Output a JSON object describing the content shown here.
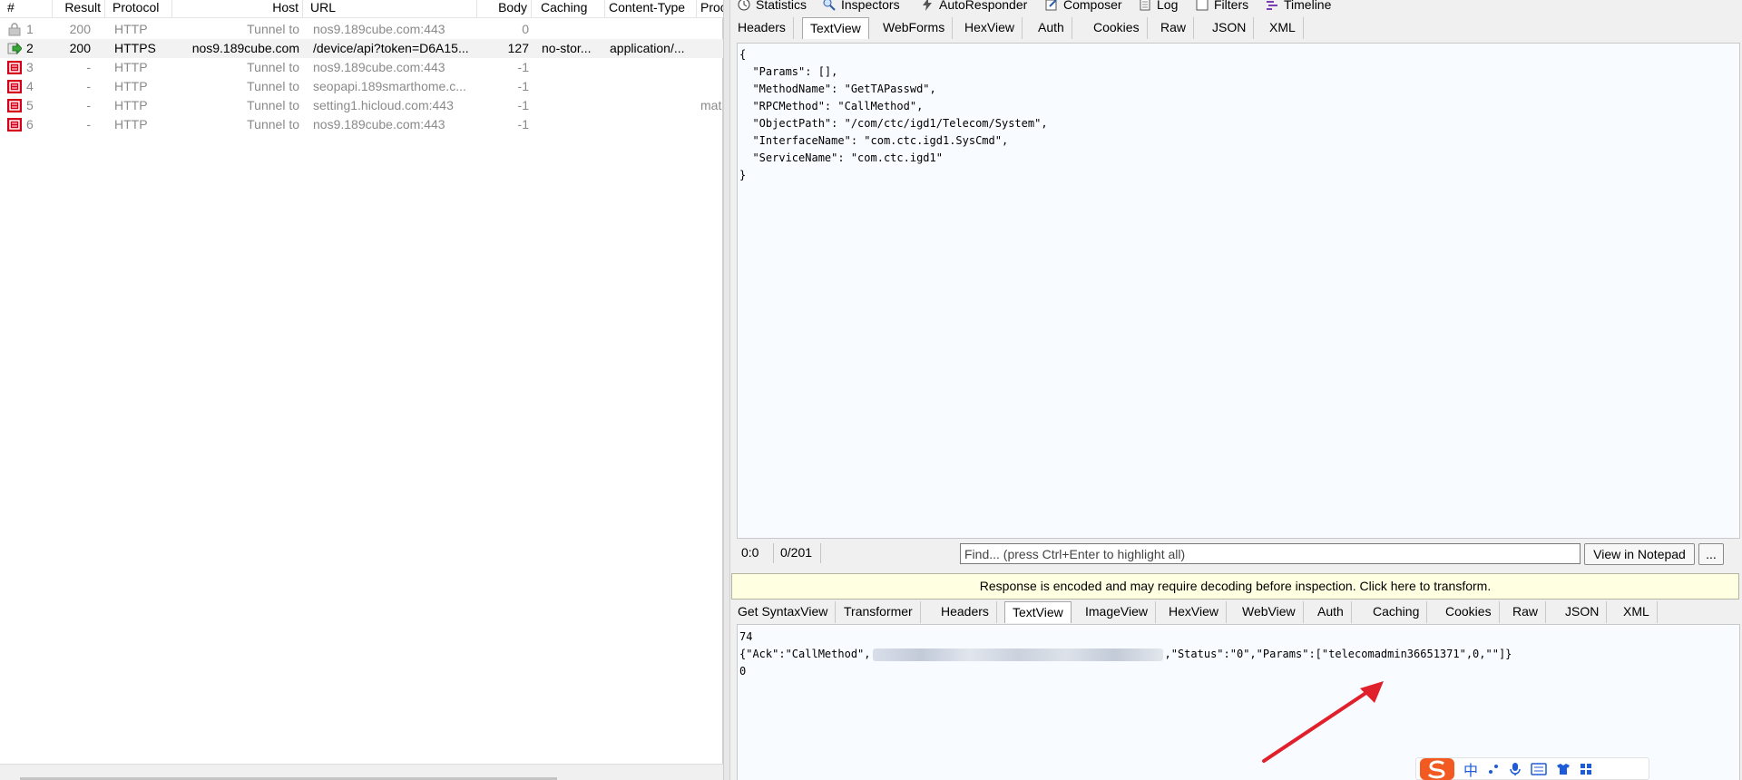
{
  "sessions": {
    "columns": [
      "#",
      "Result",
      "Protocol",
      "Host",
      "URL",
      "Body",
      "Caching",
      "Content-Type",
      "Proc"
    ],
    "rows": [
      {
        "num": "1",
        "result": "200",
        "protocol": "HTTP",
        "host": "Tunnel to",
        "url": "nos9.189cube.com:443",
        "body": "0",
        "caching": "",
        "ctype": "",
        "proc": "",
        "icon": "lock-icon",
        "state": "dim"
      },
      {
        "num": "2",
        "result": "200",
        "protocol": "HTTPS",
        "host": "nos9.189cube.com",
        "url": "/device/api?token=D6A15...",
        "body": "127",
        "caching": "no-stor...",
        "ctype": "application/...",
        "proc": "",
        "icon": "arrow-right-icon",
        "state": "selected"
      },
      {
        "num": "3",
        "result": "-",
        "protocol": "HTTP",
        "host": "Tunnel to",
        "url": "nos9.189cube.com:443",
        "body": "-1",
        "caching": "",
        "ctype": "",
        "proc": "",
        "icon": "error-icon",
        "state": "dim"
      },
      {
        "num": "4",
        "result": "-",
        "protocol": "HTTP",
        "host": "Tunnel to",
        "url": "seopapi.189smarthome.c...",
        "body": "-1",
        "caching": "",
        "ctype": "",
        "proc": "",
        "icon": "error-icon",
        "state": "dim"
      },
      {
        "num": "5",
        "result": "-",
        "protocol": "HTTP",
        "host": "Tunnel to",
        "url": "setting1.hicloud.com:443",
        "body": "-1",
        "caching": "",
        "ctype": "",
        "proc": "mat",
        "icon": "error-icon",
        "state": "dim"
      },
      {
        "num": "6",
        "result": "-",
        "protocol": "HTTP",
        "host": "Tunnel to",
        "url": "nos9.189cube.com:443",
        "body": "-1",
        "caching": "",
        "ctype": "",
        "proc": "",
        "icon": "error-icon",
        "state": "dim"
      }
    ]
  },
  "main_tabs": [
    {
      "label": "Statistics",
      "icon": "clock-icon"
    },
    {
      "label": "Inspectors",
      "icon": "inspect-icon"
    },
    {
      "label": "AutoResponder",
      "icon": "lightning-icon"
    },
    {
      "label": "Composer",
      "icon": "compose-icon"
    },
    {
      "label": "Log",
      "icon": "log-icon"
    },
    {
      "label": "Filters",
      "icon": "checkbox-icon"
    },
    {
      "label": "Timeline",
      "icon": "timeline-icon"
    }
  ],
  "request": {
    "tabs": [
      "Headers",
      "TextView",
      "WebForms",
      "HexView",
      "Auth",
      "Cookies",
      "Raw",
      "JSON",
      "XML"
    ],
    "active_tab": "TextView",
    "body": "{\n  \"Params\": [],\n  \"MethodName\": \"GetTAPasswd\",\n  \"RPCMethod\": \"CallMethod\",\n  \"ObjectPath\": \"/com/ctc/igd1/Telecom/System\",\n  \"InterfaceName\": \"com.ctc.igd1.SysCmd\",\n  \"ServiceName\": \"com.ctc.igd1\"\n}",
    "cursor_pos": "0:0",
    "char_count": "0/201",
    "find_placeholder": "Find... (press Ctrl+Enter to highlight all)",
    "view_notepad": "View in Notepad",
    "more": "..."
  },
  "response": {
    "banner": "Response is encoded and may require decoding before inspection. Click here to transform.",
    "tabs": [
      "Get SyntaxView",
      "Transformer",
      "Headers",
      "TextView",
      "ImageView",
      "HexView",
      "WebView",
      "Auth",
      "Caching",
      "Cookies",
      "Raw",
      "JSON",
      "XML"
    ],
    "active_tab": "TextView",
    "line1": "74",
    "line2_prefix": "{\"Ack\":\"CallMethod\",",
    "line2_suffix": ",\"Status\":\"0\",\"Params\":[\"telecomadmin36651371\",0,\"\"]}",
    "line3": "0"
  },
  "ime_icons": [
    "sogou-logo-icon",
    "chinese-mode-icon",
    "punctuation-icon",
    "microphone-icon",
    "keyboard-icon",
    "skin-icon",
    "apps-icon"
  ],
  "ime_text": "中"
}
